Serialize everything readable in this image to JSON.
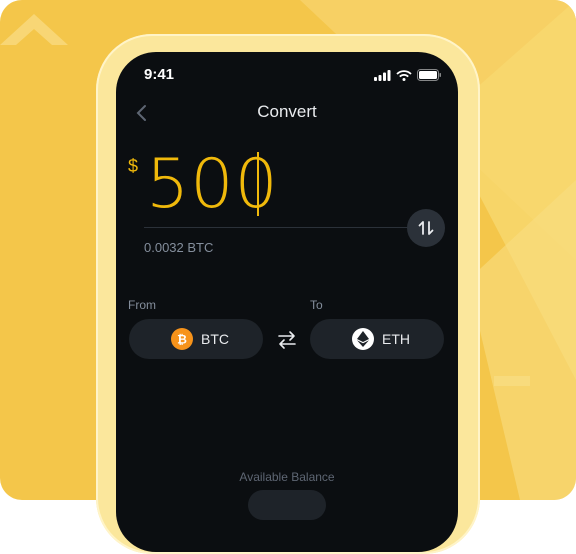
{
  "status_bar": {
    "time": "9:41"
  },
  "header": {
    "title": "Convert"
  },
  "amount": {
    "currency_symbol": "$",
    "value": "500",
    "equivalent": "0.0032 BTC"
  },
  "from": {
    "label": "From",
    "coin": "BTC",
    "icon": "bitcoin-icon",
    "color": "#f7931a"
  },
  "to": {
    "label": "To",
    "coin": "ETH",
    "icon": "ethereum-icon",
    "color": "#ffffff"
  },
  "footer": {
    "available_balance_label": "Available Balance"
  },
  "colors": {
    "accent": "#f0b90b",
    "background": "#f4c64a",
    "screen": "#0b0e11"
  }
}
